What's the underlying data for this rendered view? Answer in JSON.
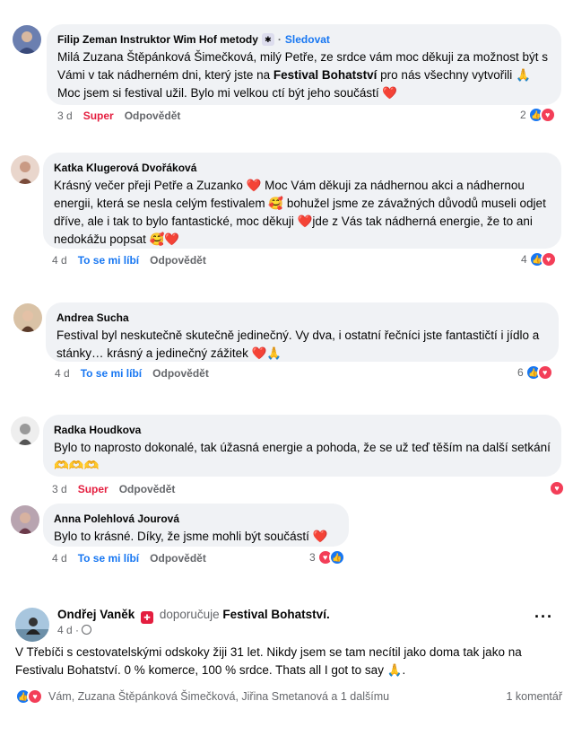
{
  "comments": [
    {
      "author": "Filip Zeman Instruktor Wim Hof metody",
      "follow": "Sledovat",
      "text_before": "Milá Zuzana Štěpánková Šimečková, milý Petře, ze srdce vám moc děkuji za možnost být s Vámi v tak nádherném dni, který jste na ",
      "text_bold": "Festival Bohatství",
      "text_after": " pro nás všechny vytvořili 🙏 Moc jsem si festival užil. Bylo mi velkou ctí být jeho součástí ❤️",
      "time": "3 d",
      "reaction_label": "Super",
      "reply": "Odpovědět",
      "reaction_count": "2"
    },
    {
      "author": "Katka Klugerová Dvořáková",
      "text": "Krásný večer přeji Petře a Zuzanko ❤️ Moc Vám děkuji za nádhernou akci a nádhernou energii, která se nesla celým festivalem 🥰 bohužel jsme ze závažných důvodů museli odjet dříve, ale i tak to bylo fantastické, moc děkuji ❤️jde z Vás tak nádherná energie, že to ani nedokážu popsat 🥰❤️",
      "time": "4 d",
      "reaction_label": "To se mi líbí",
      "reply": "Odpovědět",
      "reaction_count": "4"
    },
    {
      "author": "Andrea Sucha",
      "text": "Festival byl neskutečně skutečně jedinečný. Vy dva, i ostatní řečníci jste fantastičtí i jídlo a stánky… krásný a jedinečný zážitek ❤️🙏",
      "time": "4 d",
      "reaction_label": "To se mi líbí",
      "reply": "Odpovědět",
      "reaction_count": "6"
    },
    {
      "author": "Radka Houdkova",
      "text": "Bylo to naprosto dokonalé, tak úžasná energie a pohoda, že se už teď těším na další setkání 🫶🫶🫶",
      "time": "3 d",
      "reaction_label": "Super",
      "reply": "Odpovědět",
      "reaction_count": ""
    },
    {
      "author": "Anna Polehlová Jourová",
      "text": "Bylo to krásné. Díky, že jsme mohli být součástí ❤️",
      "time": "4 d",
      "reaction_label": "To se mi líbí",
      "reply": "Odpovědět",
      "reaction_count": "3"
    }
  ],
  "post": {
    "author": "Ondřej Vaněk",
    "recommends": "doporučuje",
    "page": "Festival Bohatství.",
    "time": "4 d",
    "text": "V Třebíči s cestovatelskými odskoky žiji 31 let. Nikdy jsem se tam necítil jako doma tak jako na Festivalu Bohatství. 0 % komerce, 100 % srdce. Thats all I got to say 🙏.",
    "reactors": "Vám, Zuzana Štěpánková Šimečková, Jiřina Smetanová a 1 dalšímu",
    "comment_count": "1 komentář",
    "more": "···"
  },
  "colors": {
    "bubble": "#f0f2f5",
    "link": "#1877f2",
    "love": "#e41e3f",
    "meta": "#65676b"
  }
}
